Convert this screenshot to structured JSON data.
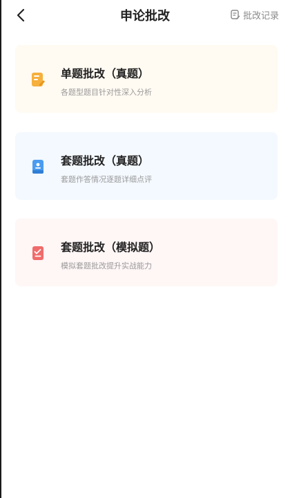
{
  "header": {
    "title": "申论批改",
    "records_label": "批改记录"
  },
  "cards": [
    {
      "title": "单题批改（真题）",
      "desc": "各题型题目针对性深入分析",
      "icon": "document-edit-icon",
      "accent": "#f5b03d"
    },
    {
      "title": "套题批改（真题）",
      "desc": "套题作答情况逐题详细点评",
      "icon": "book-icon",
      "accent": "#4a9cf0"
    },
    {
      "title": "套题批改（模拟题）",
      "desc": "模拟套题批改提升实战能力",
      "icon": "checklist-icon",
      "accent": "#f06b6b"
    }
  ],
  "colors": {
    "text_primary": "#222222",
    "text_secondary": "#9a9a9a"
  }
}
